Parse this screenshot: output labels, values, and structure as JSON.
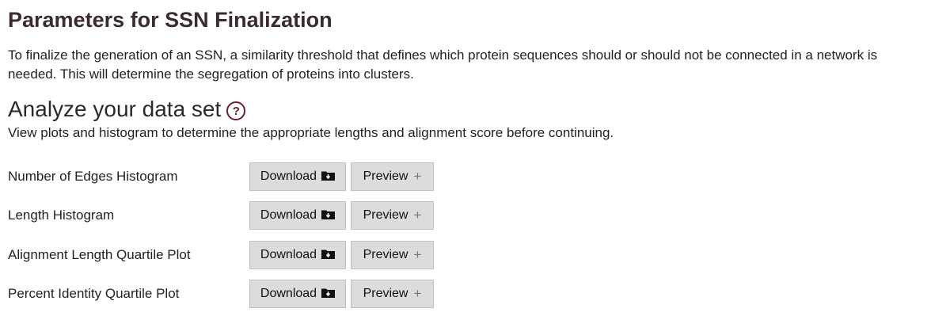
{
  "page": {
    "title": "Parameters for SSN Finalization",
    "intro": "To finalize the generation of an SSN, a similarity threshold that defines which protein sequences should or should not be connected in a network is needed. This will determine the segregation of proteins into clusters."
  },
  "analyze": {
    "title": "Analyze your data set",
    "help_symbol": "?",
    "description": "View plots and histogram to determine the appropriate lengths and alignment score before continuing."
  },
  "plots": [
    {
      "label": "Number of Edges Histogram",
      "download_label": "Download",
      "preview_label": "Preview",
      "preview_symbol": "+"
    },
    {
      "label": "Length Histogram",
      "download_label": "Download",
      "preview_label": "Preview",
      "preview_symbol": "+"
    },
    {
      "label": "Alignment Length Quartile Plot",
      "download_label": "Download",
      "preview_label": "Preview",
      "preview_symbol": "+"
    },
    {
      "label": "Percent Identity Quartile Plot",
      "download_label": "Download",
      "preview_label": "Preview",
      "preview_symbol": "+"
    }
  ],
  "icons": {
    "help": "question-circle-icon",
    "download": "folder-download-icon",
    "preview": "plus-icon"
  },
  "colors": {
    "title": "#3b2b2e",
    "help_accent": "#6b1f2f",
    "button_bg": "#dcdcdc",
    "button_border": "#c2c2c2"
  }
}
